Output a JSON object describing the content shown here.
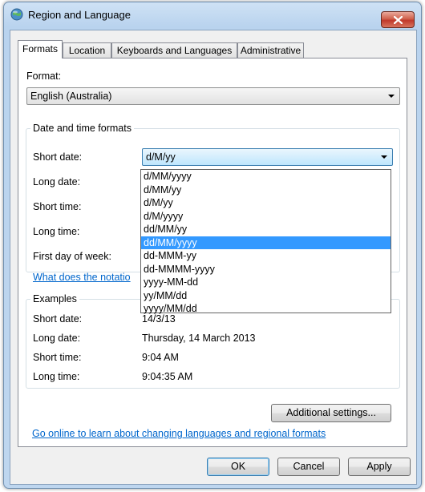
{
  "window": {
    "title": "Region and Language"
  },
  "tabs": [
    {
      "label": "Formats"
    },
    {
      "label": "Location"
    },
    {
      "label": "Keyboards and Languages"
    },
    {
      "label": "Administrative"
    }
  ],
  "format": {
    "label": "Format:",
    "value": "English (Australia)"
  },
  "date_time_group": {
    "title": "Date and time formats",
    "short_date_label": "Short date:",
    "short_date_value": "d/M/yy",
    "long_date_label": "Long date:",
    "short_time_label": "Short time:",
    "long_time_label": "Long time:",
    "first_day_label": "First day of week:",
    "help_link": "What does the notatio"
  },
  "dropdown_options": [
    "d/MM/yyyy",
    "d/MM/yy",
    "d/M/yy",
    "d/M/yyyy",
    "dd/MM/yy",
    "dd/MM/yyyy",
    "dd-MMM-yy",
    "dd-MMMM-yyyy",
    "yyyy-MM-dd",
    "yy/MM/dd",
    "yyyy/MM/dd"
  ],
  "dropdown_selected_option": "dd/MM/yyyy",
  "examples": {
    "title": "Examples",
    "short_date_label": "Short date:",
    "short_date_value": "14/3/13",
    "long_date_label": "Long date:",
    "long_date_value": "Thursday, 14 March 2013",
    "short_time_label": "Short time:",
    "short_time_value": "9:04 AM",
    "long_time_label": "Long time:",
    "long_time_value": "9:04:35 AM"
  },
  "additional_settings_label": "Additional settings...",
  "online_link": "Go online to learn about changing languages and regional formats",
  "buttons": {
    "ok": "OK",
    "cancel": "Cancel",
    "apply": "Apply"
  },
  "colors": {
    "accent_link": "#0066cc",
    "selection": "#3399ff",
    "close_button": "#c0392b"
  }
}
